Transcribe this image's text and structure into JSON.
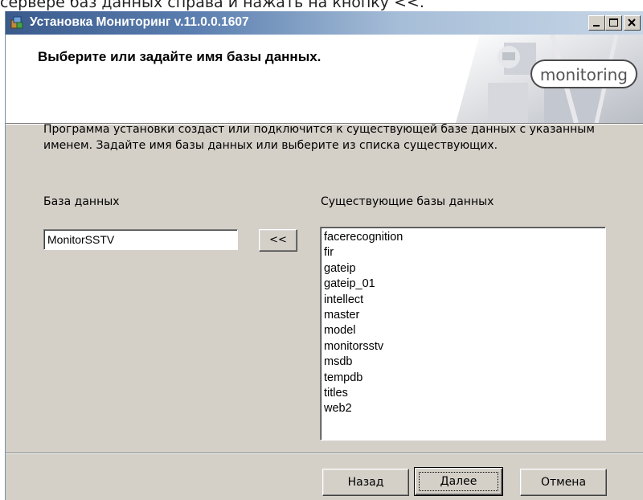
{
  "top_caption": "серверe баз данных справа и нажать на кнопку <<.",
  "window": {
    "title": "Установка Мониторинг v.11.0.0.1607"
  },
  "header": {
    "title": "Выберите или задайте имя базы данных.",
    "logo_text": "monitoring"
  },
  "description": "Программа установки создаст или подключится к существующей базе данных с указанным именем. Задайте имя базы данных или выберите из списка существующих.",
  "form": {
    "db_label": "База данных",
    "db_value": "MonitorSSTV",
    "copy_button": "<<",
    "existing_label": "Существующие базы данных",
    "existing": [
      "facerecognition",
      "fir",
      "gateip",
      "gateip_01",
      "intellect",
      "master",
      "model",
      "monitorsstv",
      "msdb",
      "tempdb",
      "titles",
      "web2"
    ]
  },
  "buttons": {
    "back": "Назад",
    "next": "Далее",
    "cancel": "Отмена"
  },
  "colors": {
    "titlebar_start": "#3a5a8c",
    "titlebar_end": "#c7d6e6",
    "dialog_bg": "#d4d0c8"
  },
  "icons": {
    "title": "installer-icon",
    "minimize": "minimize-icon",
    "maximize": "maximize-icon",
    "close": "close-icon"
  }
}
